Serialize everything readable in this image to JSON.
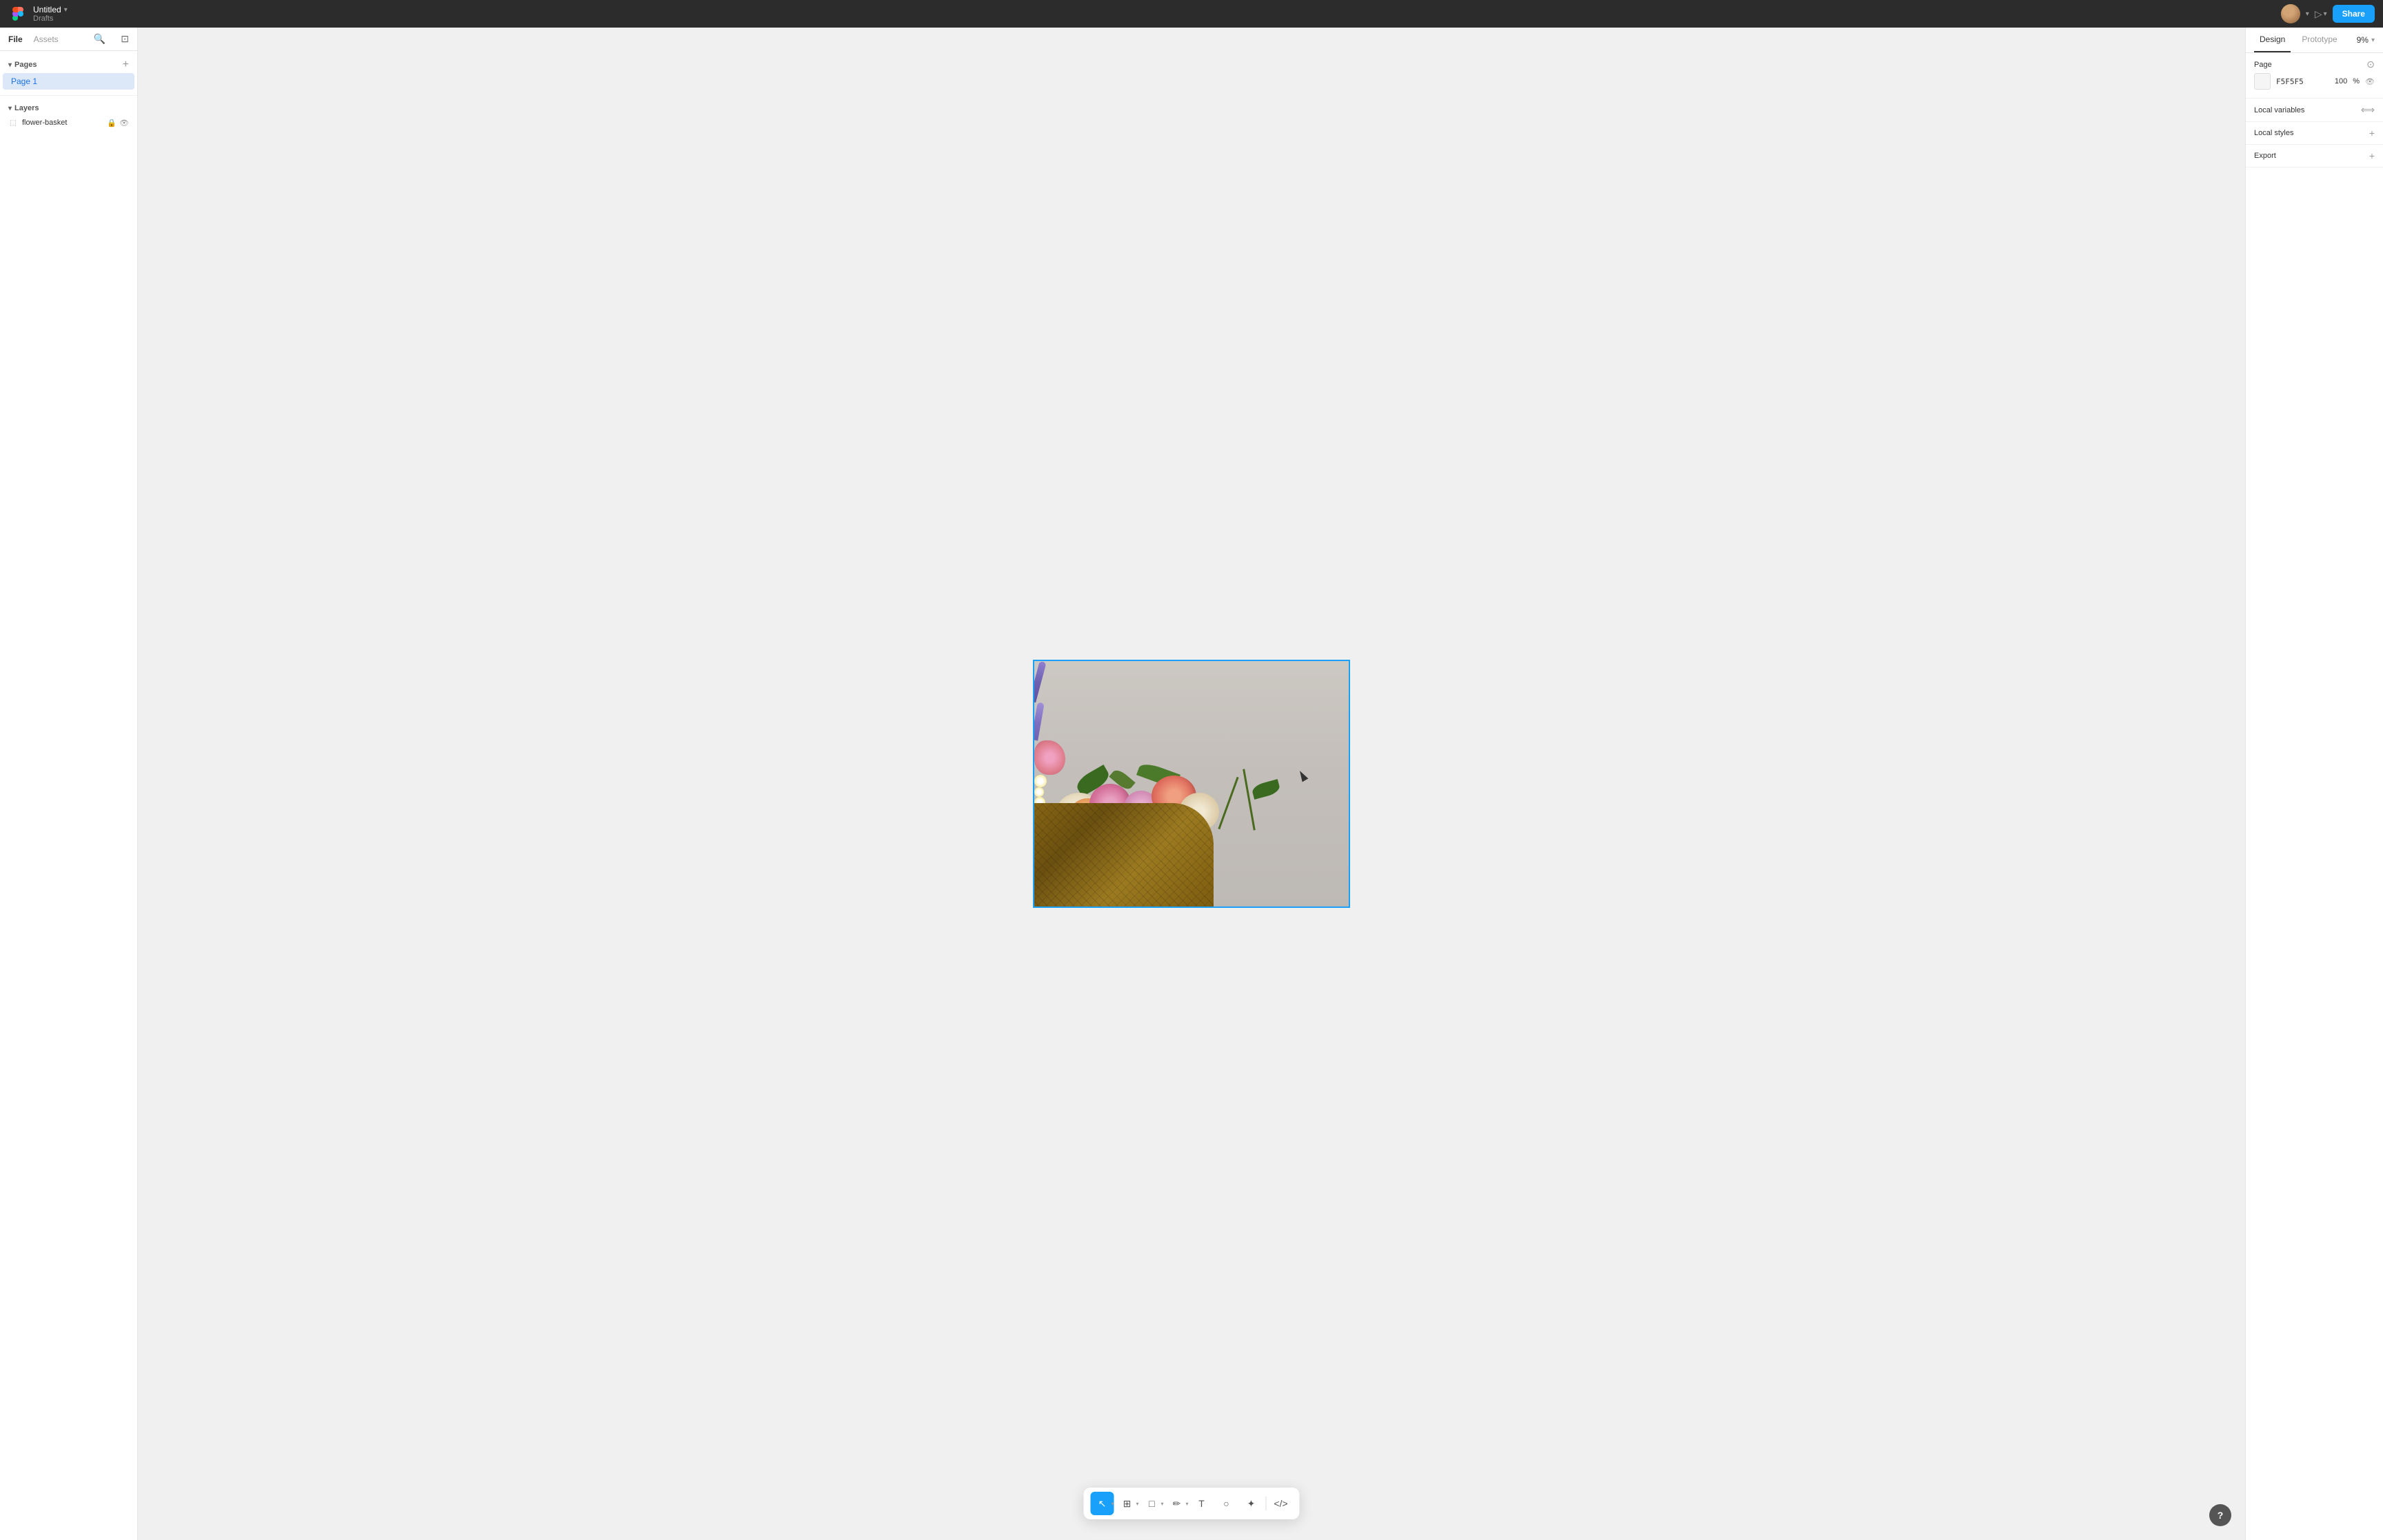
{
  "topbar": {
    "title": "Untitled",
    "subtitle": "Drafts",
    "share_label": "Share",
    "zoom_level": "9%"
  },
  "left_panel": {
    "tabs": [
      {
        "label": "File",
        "active": true
      },
      {
        "label": "Assets",
        "active": false
      }
    ],
    "pages_section": {
      "title": "Pages",
      "pages": [
        {
          "label": "Page 1",
          "active": true
        }
      ]
    },
    "layers_section": {
      "title": "Layers",
      "items": [
        {
          "label": "flower-basket",
          "icon": "image-icon",
          "locked": true,
          "visible": true
        }
      ]
    }
  },
  "right_panel": {
    "tabs": [
      {
        "label": "Design",
        "active": true
      },
      {
        "label": "Prototype",
        "active": false
      }
    ],
    "page_section": {
      "title": "Page",
      "color_value": "F5F5F5",
      "opacity_value": "100",
      "opacity_unit": "%"
    },
    "local_variables": {
      "title": "Local variables"
    },
    "local_styles": {
      "title": "Local styles"
    },
    "export": {
      "title": "Export"
    }
  },
  "toolbar": {
    "tools": [
      {
        "name": "select",
        "label": "Select",
        "active": true,
        "icon": "▲"
      },
      {
        "name": "frame",
        "label": "Frame",
        "active": false,
        "icon": "⊞"
      },
      {
        "name": "shape",
        "label": "Shape",
        "active": false,
        "icon": "□"
      },
      {
        "name": "pen",
        "label": "Pen",
        "active": false,
        "icon": "⬡"
      },
      {
        "name": "text",
        "label": "Text",
        "active": false,
        "icon": "T"
      },
      {
        "name": "ellipse",
        "label": "Ellipse",
        "active": false,
        "icon": "○"
      },
      {
        "name": "components",
        "label": "Components",
        "active": false,
        "icon": "✦"
      },
      {
        "name": "code",
        "label": "Code",
        "active": false,
        "icon": "<>"
      }
    ]
  },
  "help": {
    "label": "?"
  }
}
